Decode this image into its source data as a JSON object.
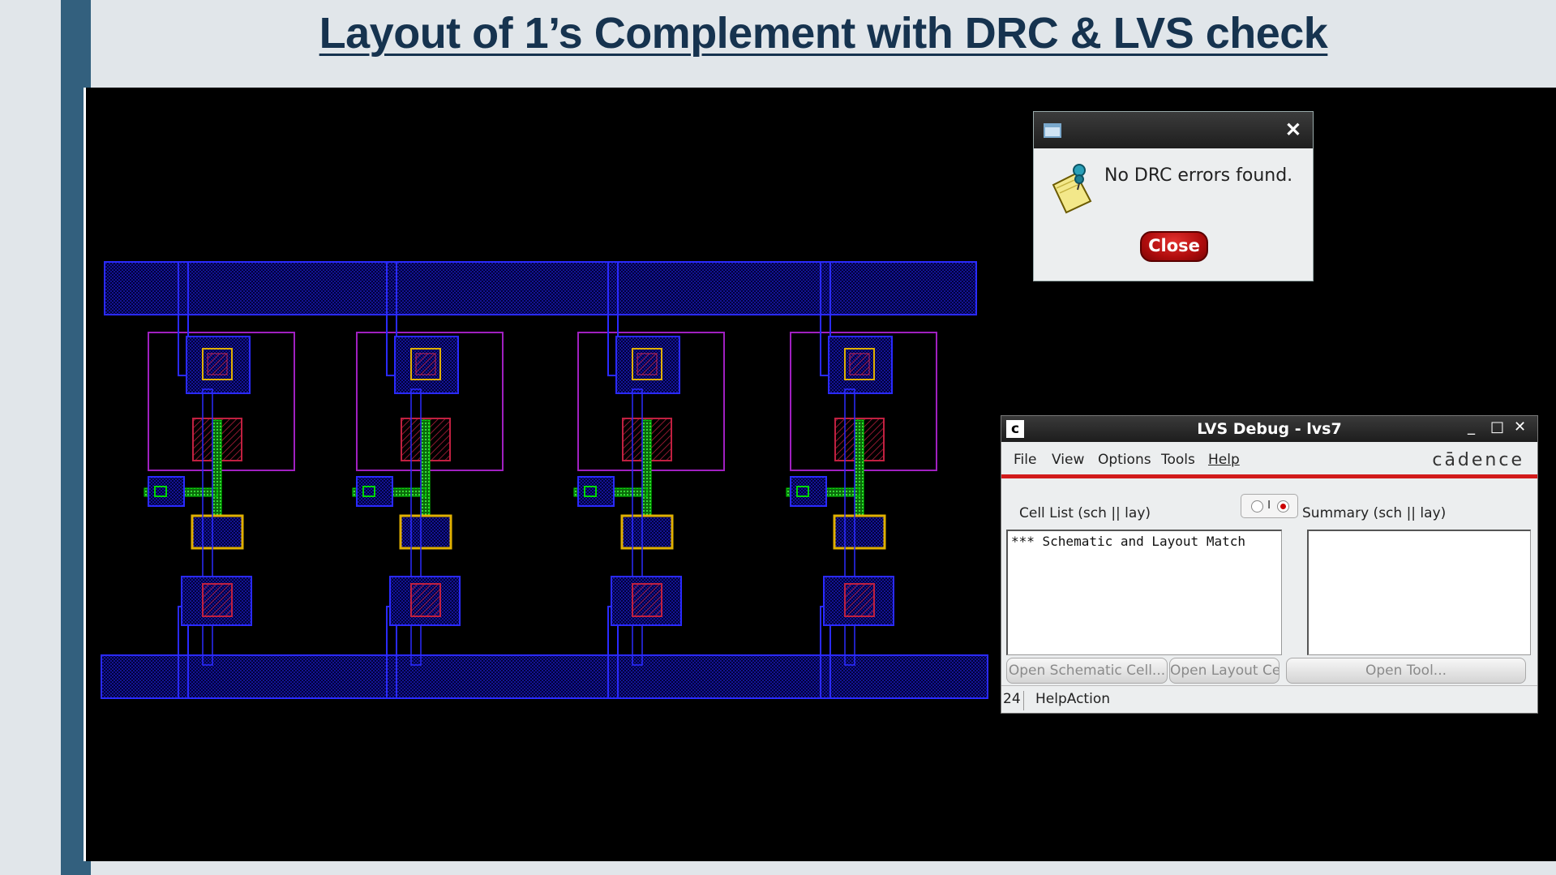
{
  "slide": {
    "title": "Layout of 1’s Complement with DRC & LVS check"
  },
  "drc_dialog": {
    "message": "No DRC errors found.",
    "close_button": "Close",
    "close_icon": "close-icon",
    "window_icon": "window-icon",
    "note_icon": "notepad-pin-icon"
  },
  "lvs_window": {
    "title": "LVS Debug - lvs7",
    "app_icon": "c",
    "window_controls": {
      "minimize": "_",
      "maximize": "□",
      "close": "✕"
    },
    "menu": [
      "File",
      "View",
      "Options",
      "Tools",
      "Help"
    ],
    "logo": "cādence",
    "cell_list_label": "Cell List (sch || lay)",
    "summary_label": "Summary (sch || lay)",
    "radio_separator": "I",
    "cell_list_items": [
      "*** Schematic and Layout Match"
    ],
    "buttons": {
      "open_schematic": "Open Schematic Cell...",
      "open_layout": "Open Layout Cell...",
      "open_tool": "Open Tool..."
    },
    "status": {
      "number": "24",
      "text": "HelpAction"
    }
  },
  "colors": {
    "slide_bg": "#e1e6ea",
    "accent_bar": "#33607e",
    "title": "#16334f",
    "metal1": "#1a1aff",
    "poly": "#00d800",
    "nwell": "#a020c0",
    "contact": "#e0b000",
    "diffusion": "#c02040",
    "menubar_accent": "#d21b1b"
  }
}
